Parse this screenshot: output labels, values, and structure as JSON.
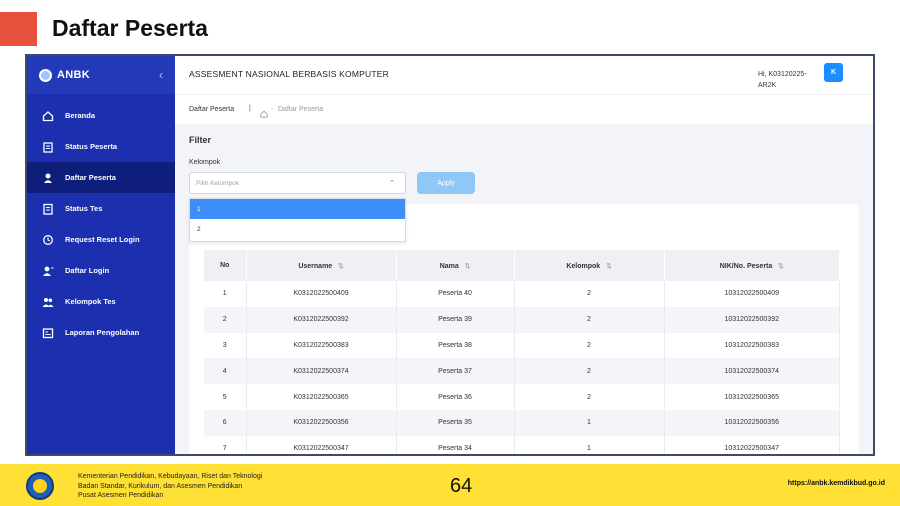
{
  "slide": {
    "title": "Daftar Peserta",
    "accent_color": "#e8513d"
  },
  "sidebar": {
    "brand": "ANBK",
    "collapse_glyph": "‹",
    "items": [
      {
        "label": "Beranda",
        "icon": "home-icon"
      },
      {
        "label": "Status Peserta",
        "icon": "clipboard-icon"
      },
      {
        "label": "Daftar Peserta",
        "icon": "user-icon",
        "active": true
      },
      {
        "label": "Status Tes",
        "icon": "checklist-icon"
      },
      {
        "label": "Request Reset Login",
        "icon": "reset-icon"
      },
      {
        "label": "Daftar Login",
        "icon": "user-login-icon"
      },
      {
        "label": "Kelompok Tes",
        "icon": "users-group-icon"
      },
      {
        "label": "Laporan Pengolahan",
        "icon": "report-icon"
      }
    ],
    "color": "#1c2fae"
  },
  "header": {
    "app_title": "ASSESMENT NASIONAL BERBASIS KOMPUTER",
    "user_greeting_line1": "Hi, K03120225-",
    "user_greeting_line2": "AR2K",
    "avatar_letter": "K"
  },
  "breadcrumb": {
    "page_title": "Daftar Peserta",
    "separator": "|",
    "home_icon": "home-icon",
    "dash": "-",
    "current": "Daftar Peserta"
  },
  "filter": {
    "title": "Filter",
    "label": "Kelompok",
    "placeholder": "Pilih Kelompok",
    "caret": "⌃",
    "apply_label": "Apply",
    "options": [
      "1",
      "2"
    ],
    "highlighted_option": "1"
  },
  "table": {
    "columns": [
      "No",
      "Username",
      "Nama",
      "Kelompok",
      "NIK/No. Peserta"
    ],
    "sort_glyph": "⇅",
    "rows": [
      [
        "1",
        "K0312022500409",
        "Peserta 40",
        "2",
        "10312022500409"
      ],
      [
        "2",
        "K0312022500392",
        "Peserta 39",
        "2",
        "10312022500392"
      ],
      [
        "3",
        "K0312022500383",
        "Peserta 38",
        "2",
        "10312022500383"
      ],
      [
        "4",
        "K0312022500374",
        "Peserta 37",
        "2",
        "10312022500374"
      ],
      [
        "5",
        "K0312022500365",
        "Peserta 36",
        "2",
        "10312022500365"
      ],
      [
        "6",
        "K0312022500356",
        "Peserta 35",
        "1",
        "10312022500356"
      ],
      [
        "7",
        "K0312022500347",
        "Peserta 34",
        "1",
        "10312022500347"
      ]
    ]
  },
  "footer": {
    "line1": "Kementerian Pendidikan, Kebudayaan, Riset dan Teknologi",
    "line2": "Badan Standar, Kurikulum, dan Asesmen Pendidikan",
    "line3": "Pusat Asesmen Pendidikan",
    "page_number": "64",
    "url": "https://anbk.kemdikbud.go.id",
    "color": "#ffe135"
  }
}
